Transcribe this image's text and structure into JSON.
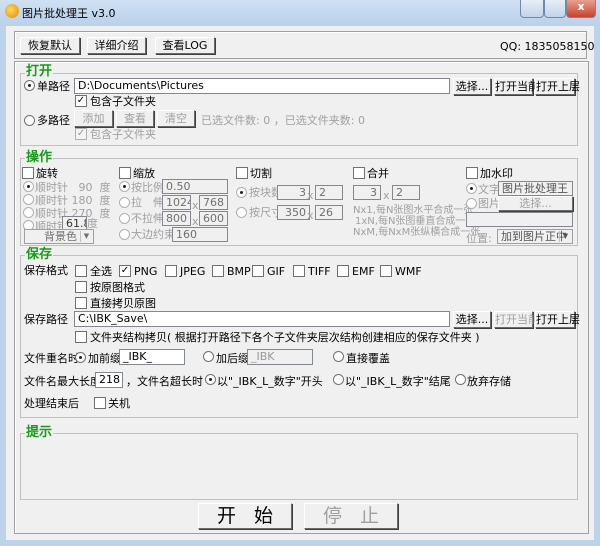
{
  "window": {
    "title": "图片批处理王 v3.0",
    "close": "x"
  },
  "toolbar": {
    "restore": "恢复默认",
    "details": "详细介绍",
    "log": "查看LOG",
    "qq": "QQ: 1835058150"
  },
  "open": {
    "title": "打开",
    "single_path_label": "单路径",
    "single_path_value": "D:\\Documents\\Pictures",
    "choose": "选择...",
    "open_current": "打开当前",
    "open_parent": "打开上层",
    "include_sub": "包含子文件夹",
    "multi_path_label": "多路径",
    "add": "添加",
    "view": "查看",
    "clear": "清空",
    "selected_files_label": "已选文件数:",
    "selected_files": "0",
    "sep": "，",
    "selected_folders_label": "已选文件夹数:",
    "selected_folders": "0",
    "include_sub2": "包含子文件夹"
  },
  "ops": {
    "title": "操作",
    "rotate": {
      "label": "旋转",
      "cw": "顺时针",
      "deg90": "90",
      "deg180": "180",
      "deg270": "270",
      "custom": "61.8",
      "unit": "度",
      "bg": "背景色"
    },
    "scale": {
      "label": "缩放",
      "ratio": "按比例",
      "ratio_val": "0.50",
      "stretch": "拉　伸",
      "stretch_w": "1024",
      "stretch_h": "768",
      "nostretch": "不拉伸",
      "nostretch_w": "800",
      "nostretch_h": "600",
      "x": "x",
      "maxside": "大边约束",
      "maxside_val": "160"
    },
    "cut": {
      "label": "切割",
      "by_blocks": "按块数",
      "blocks_a": "3",
      "blocks_b": "2",
      "by_size": "按尺寸",
      "size_a": "350",
      "size_b": "26"
    },
    "merge": {
      "label": "合并",
      "a": "3",
      "b": "2",
      "hint1": "Nx1,每N张图水平合成一张",
      "hint2": "1xN,每N张图垂直合成一张",
      "hint3": "NxM,每NxM张纵横合成一张"
    },
    "watermark": {
      "label": "加水印",
      "text": "文字",
      "text_val": "图片批处理王",
      "image": "图片",
      "choose": "选择...",
      "position_label": "位置:",
      "position": "加到图片正中"
    }
  },
  "save": {
    "title": "保存",
    "format_label": "保存格式",
    "formats": [
      {
        "label": "全选",
        "checked": false
      },
      {
        "label": "PNG",
        "checked": true
      },
      {
        "label": "JPEG",
        "checked": false
      },
      {
        "label": "BMP",
        "checked": false
      },
      {
        "label": "GIF",
        "checked": false
      },
      {
        "label": "TIFF",
        "checked": false
      },
      {
        "label": "EMF",
        "checked": false
      },
      {
        "label": "WMF",
        "checked": false
      }
    ],
    "orig_format": "按原图格式",
    "copy_orig": "直接拷贝原图",
    "path_label": "保存路径",
    "path_value": "C:\\IBK_Save\\",
    "choose": "选择...",
    "open_current": "打开当前",
    "open_parent": "打开上层",
    "folder_copy": "文件夹结构拷贝( 根据打开路径下各个子文件夹层次结构创建相应的保存文件夹 )",
    "rename_label": "文件重名时",
    "prefix": "加前缀",
    "prefix_val": "_IBK_",
    "suffix": "加后缀",
    "suffix_val": "_IBK",
    "overwrite": "直接覆盖",
    "maxlen_label": "文件名最大长度",
    "maxlen": "218",
    "toolong": "，文件名超长时",
    "start": "以\"_IBK_L_数字\"开头",
    "end": "以\"_IBK_L_数字\"结尾",
    "discard": "放弃存储",
    "after_label": "处理结束后",
    "shutdown": "关机"
  },
  "hint": {
    "title": "提示"
  },
  "actions": {
    "start": "开始",
    "stop": "停止"
  }
}
